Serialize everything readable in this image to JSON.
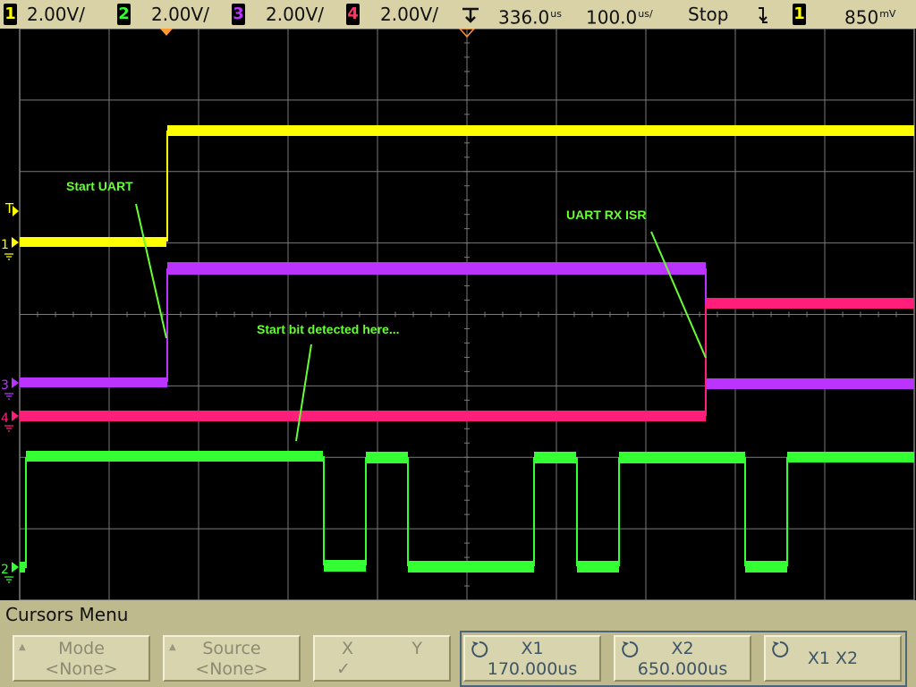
{
  "top_bar": {
    "ch1": {
      "num": "1",
      "scale": "2.00V/",
      "color": "#ffff00"
    },
    "ch2": {
      "num": "2",
      "scale": "2.00V/",
      "color": "#33ff33"
    },
    "ch3": {
      "num": "3",
      "scale": "2.00V/",
      "color": "#bb33ff"
    },
    "ch4": {
      "num": "4",
      "scale": "2.00V/",
      "color": "#ff3366"
    },
    "time_delay": "336.0",
    "time_delay_unit": "us",
    "time_div": "100.0",
    "time_div_unit": "us/",
    "run_state": "Stop",
    "trigger_source": "1",
    "trigger_level": "850",
    "trigger_level_unit": "mV"
  },
  "screen": {
    "annotations": {
      "start_uart": "Start UART",
      "uart_rx_isr": "UART RX ISR",
      "start_bit": "Start bit detected here..."
    },
    "markers": {
      "trigger_T": "T",
      "ch1": "1",
      "ch2": "2",
      "ch3": "3",
      "ch4": "4"
    },
    "colors": {
      "ch1": "#ffff00",
      "ch2": "#33ff33",
      "ch3": "#bb33ff",
      "ch4": "#ff1f7a",
      "annotation": "#66ff33",
      "grid": "#7a7a7a",
      "trigger_marker": "#ff9933"
    }
  },
  "menu": {
    "title": "Cursors Menu",
    "softkeys": [
      {
        "top": "Mode",
        "bottom": "<None>"
      },
      {
        "top": "Source",
        "bottom": "<None>"
      },
      {
        "top_left": "X",
        "top_right": "Y",
        "bottom": "✓"
      },
      {
        "top": "X1",
        "bottom": "170.000us"
      },
      {
        "top": "X2",
        "bottom": "650.000us"
      },
      {
        "top": "X1 X2",
        "bottom": ""
      }
    ]
  }
}
